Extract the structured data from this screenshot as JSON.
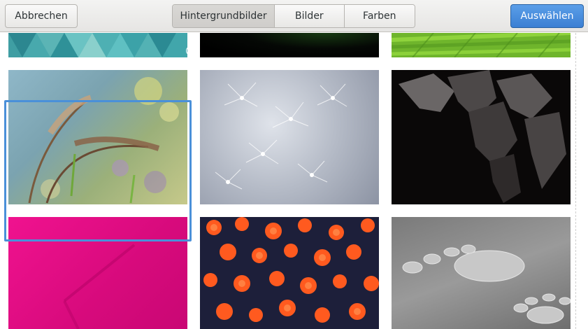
{
  "header": {
    "cancel_label": "Abbrechen",
    "select_label": "Auswählen",
    "tabs": [
      {
        "label": "Hintergrundbilder",
        "active": true
      },
      {
        "label": "Bilder",
        "active": false
      },
      {
        "label": "Farben",
        "active": false
      }
    ]
  },
  "colors": {
    "accent": "#4a90d9",
    "select_button": "#3b7fd3"
  },
  "wallpapers": [
    {
      "subject": "teal geometric triangles",
      "selected": false
    },
    {
      "subject": "dark green",
      "selected": false
    },
    {
      "subject": "green leaf",
      "selected": false
    },
    {
      "subject": "grass seed heads",
      "selected": true
    },
    {
      "subject": "dandelion fluff",
      "selected": false
    },
    {
      "subject": "dark leaves with droplets",
      "selected": false
    },
    {
      "subject": "pink fabric",
      "selected": false
    },
    {
      "subject": "orange flowers",
      "selected": false
    },
    {
      "subject": "water droplets footprint",
      "selected": false
    }
  ]
}
